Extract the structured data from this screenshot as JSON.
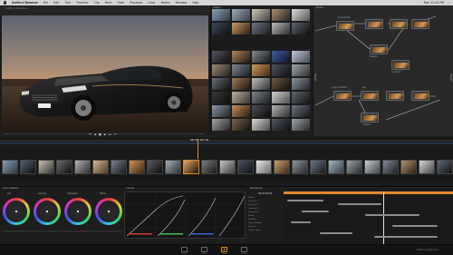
{
  "menubar": {
    "app_name": "DaVinci Resolve",
    "items": [
      "File",
      "Edit",
      "Trim",
      "Timeline",
      "Clip",
      "Mark",
      "View",
      "Playback",
      "Color",
      "Nodes",
      "Window",
      "Help"
    ],
    "clock": "Mon 12:42 PM"
  },
  "titlebar": {
    "project": "Luxury Tooling Cars",
    "left": "DaVinci Resolve"
  },
  "gallery": {
    "title": "Gallery"
  },
  "nodes": {
    "title": "Nodes",
    "labels": [
      "Serial Node",
      "Parallel",
      "Corrector",
      "Color Corrector",
      "Key",
      "Output"
    ]
  },
  "timecode": "00:01:03:10",
  "panels": {
    "wheels_title": "Color Wheels",
    "wheel_labels": [
      "Lift",
      "Gamma",
      "Highlights",
      "Offset"
    ],
    "curves_title": "Curves",
    "keyframes_title": "Keyframes",
    "keyframe_timecode": "00:01:03:10",
    "keyframe_tracks": [
      "Master",
      "Corrector 1",
      "Corrector 2",
      "Corrector 3",
      "Corrector 4",
      "Sizing",
      "Stabilizer",
      "Shape Window",
      "Reverse",
      "Output Sizing"
    ]
  },
  "pages": [
    "Media",
    "Edit",
    "Color",
    "Deliver"
  ],
  "brand": "DaVinci Resolve",
  "colors": {
    "accent_orange": "#e08b2e",
    "background": "#1b1b1c"
  }
}
